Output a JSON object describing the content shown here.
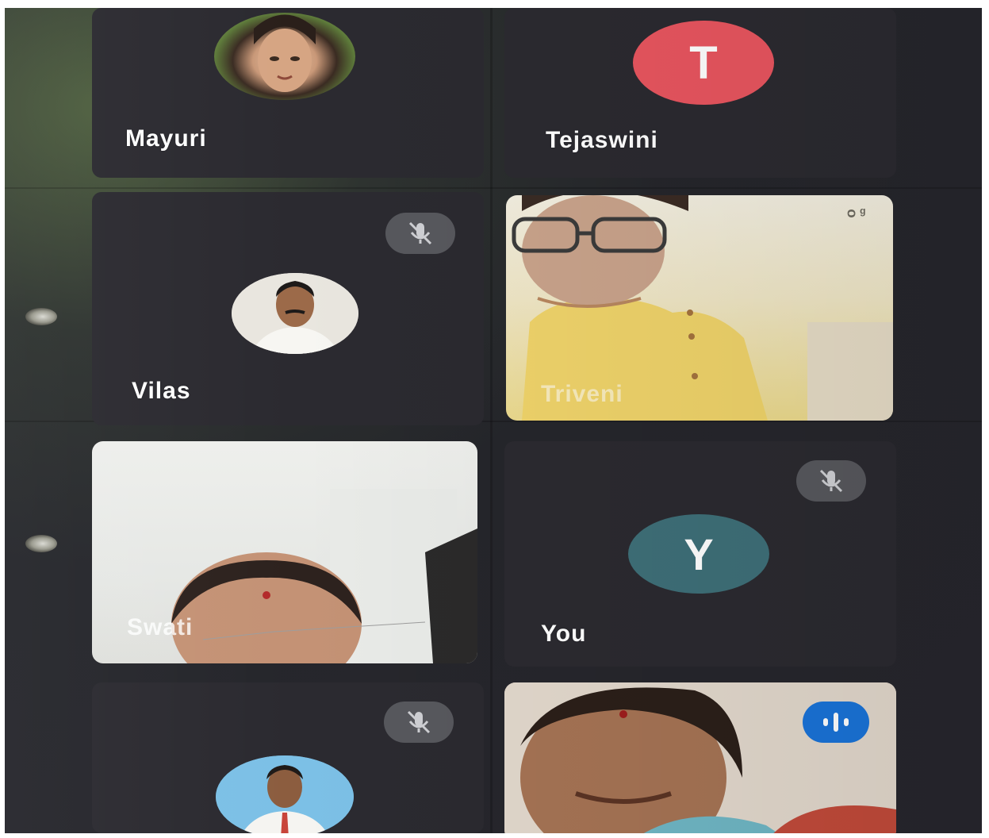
{
  "participants": {
    "mayuri": {
      "name": "Mayuri"
    },
    "tejaswini": {
      "name": "Tejaswini",
      "initial": "T",
      "avatar_color": "#e8555f"
    },
    "vilas": {
      "name": "Vilas",
      "muted": true
    },
    "triveni": {
      "name": "Triveni",
      "camera_on": true
    },
    "swati": {
      "name": "Swati",
      "camera_on": true
    },
    "you": {
      "name": "You",
      "initial": "Y",
      "avatar_color": "#3e6f78",
      "muted": true
    },
    "participant7": {
      "muted": true
    },
    "participant8": {
      "camera_on": true,
      "speaking": true
    }
  },
  "icons": {
    "mute": "mic-off-icon",
    "speaking": "audio-level-icon",
    "pin": "pin-icon"
  }
}
